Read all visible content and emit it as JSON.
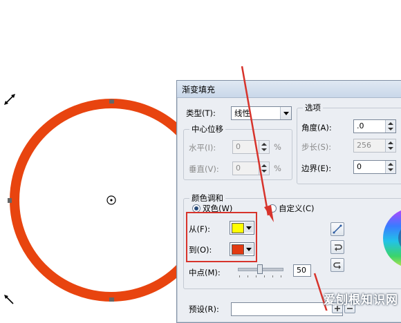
{
  "dialog": {
    "title": "渐变填充",
    "type": {
      "label": "类型(T):",
      "value": "线性"
    },
    "center_offset": {
      "title": "中心位移",
      "horizontal": {
        "label": "水平(I):",
        "value": "0",
        "unit": "%"
      },
      "vertical": {
        "label": "垂直(V):",
        "value": "0",
        "unit": "%"
      }
    },
    "options": {
      "title": "选项",
      "angle": {
        "label": "角度(A):",
        "value": ".0"
      },
      "steps": {
        "label": "步长(S):",
        "value": "256"
      },
      "border": {
        "label": "边界(E):",
        "value": "0"
      }
    },
    "color_blend": {
      "title": "颜色调和",
      "two_color": "双色(W)",
      "custom": "自定义(C)",
      "from": {
        "label": "从(F):",
        "color": "#ffff00"
      },
      "to": {
        "label": "到(O):",
        "color": "#e23a12"
      },
      "midpoint": {
        "label": "中点(M):",
        "value": "50",
        "fraction": 0.5
      }
    },
    "presets": {
      "label": "预设(R):"
    }
  },
  "canvas": {
    "ring_color": "#e8440f"
  },
  "annotation_color": "#d7332b",
  "watermark": "爱刨根知识网"
}
